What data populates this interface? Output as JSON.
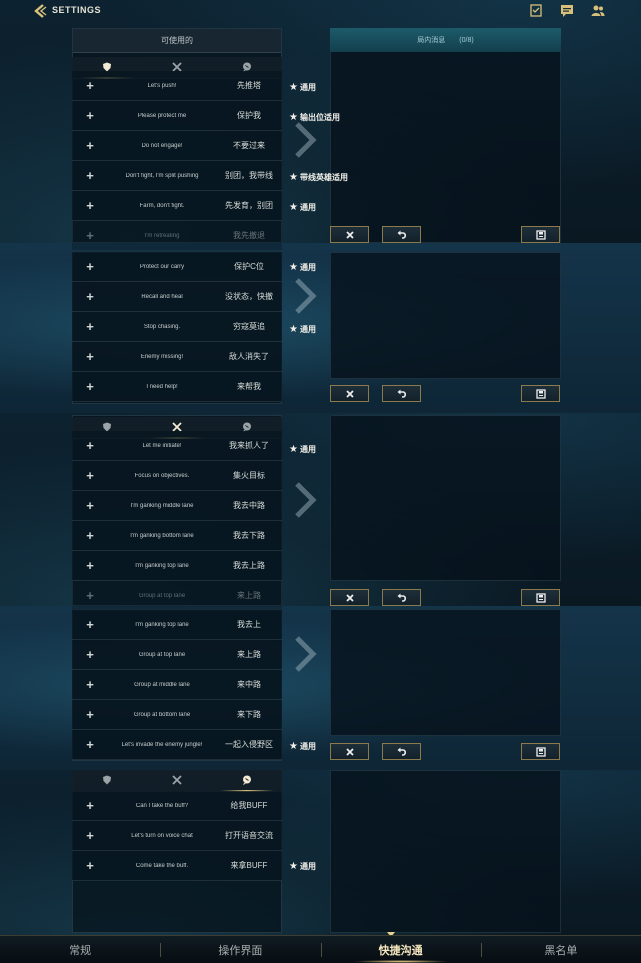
{
  "header": {
    "back_icon": "chevron-left-icon",
    "title": "SETTINGS",
    "icons": [
      "mission-icon",
      "chat-icon",
      "friends-icon"
    ]
  },
  "left_panel": {
    "title": "可使用的",
    "tabs": [
      {
        "icon": "shield-icon",
        "name": "defense"
      },
      {
        "icon": "crossed-swords-icon",
        "name": "attack"
      },
      {
        "icon": "chat-bubble-icon",
        "name": "chat"
      }
    ]
  },
  "right_panel": {
    "title": "局内消息",
    "count": "(0/8)"
  },
  "tag_star": "★",
  "plus_label": "+",
  "sections": [
    {
      "active_tab": 0,
      "rows": [
        {
          "en": "Let's push!",
          "zh": "先推塔",
          "tag": "通用"
        },
        {
          "en": "Please protect me",
          "zh": "保护我",
          "tag": "输出位适用"
        },
        {
          "en": "Do not engage!",
          "zh": "不要过来",
          "tag": ""
        },
        {
          "en": "Don't fight, I'm split pushing",
          "zh": "别团，我带线",
          "tag": "带线英雄适用"
        },
        {
          "en": "Farm, don't fight.",
          "zh": "先发育，别团",
          "tag": "通用"
        },
        {
          "en": "I'm retreating",
          "zh": "我先撤退",
          "tag": ""
        }
      ]
    },
    {
      "active_tab": 0,
      "rows": [
        {
          "en": "Protect our carry",
          "zh": "保护C位",
          "tag": "通用"
        },
        {
          "en": "Recall and heal",
          "zh": "没状态，快撤",
          "tag": ""
        },
        {
          "en": "Stop chasing.",
          "zh": "穷寇莫追",
          "tag": "通用"
        },
        {
          "en": "Enemy missing!",
          "zh": "敌人消失了",
          "tag": ""
        },
        {
          "en": "I need help!",
          "zh": "来帮我",
          "tag": ""
        }
      ]
    },
    {
      "active_tab": 1,
      "rows": [
        {
          "en": "Let me initiate!",
          "zh": "我来抓人了",
          "tag": "通用"
        },
        {
          "en": "Focus on objectives.",
          "zh": "集火目标",
          "tag": ""
        },
        {
          "en": "I'm ganking middle lane",
          "zh": "我去中路",
          "tag": ""
        },
        {
          "en": "I'm ganking bottom lane",
          "zh": "我去下路",
          "tag": ""
        },
        {
          "en": "I'm ganking top lane",
          "zh": "我去上路",
          "tag": ""
        },
        {
          "en": "Group at top lane",
          "zh": "来上路",
          "tag": ""
        }
      ]
    },
    {
      "active_tab": 1,
      "rows": [
        {
          "en": "I'm ganking top lane",
          "zh": "我去上",
          "tag": ""
        },
        {
          "en": "Group at top lane",
          "zh": "来上路",
          "tag": ""
        },
        {
          "en": "Group at middle lane",
          "zh": "来中路",
          "tag": ""
        },
        {
          "en": "Group at bottom lane",
          "zh": "来下路",
          "tag": ""
        },
        {
          "en": "Let's invade the enemy jungle!",
          "zh": "一起入侵野区",
          "tag": "通用"
        }
      ]
    },
    {
      "active_tab": 2,
      "rows": [
        {
          "en": "Can I take the buff?",
          "zh": "给我BUFF",
          "tag": ""
        },
        {
          "en": "Let's turn on voice chat",
          "zh": "打开语音交流",
          "tag": ""
        },
        {
          "en": "Come take the buff.",
          "zh": "来拿BUFF",
          "tag": "通用"
        }
      ]
    }
  ],
  "controls": {
    "clear_icon": "close-icon",
    "undo_icon": "undo-icon",
    "save_icon": "save-icon"
  },
  "bottom_nav": [
    {
      "label": "常规",
      "active": false
    },
    {
      "label": "操作界面",
      "active": false
    },
    {
      "label": "快捷沟通",
      "active": true
    },
    {
      "label": "黑名单",
      "active": false
    }
  ]
}
